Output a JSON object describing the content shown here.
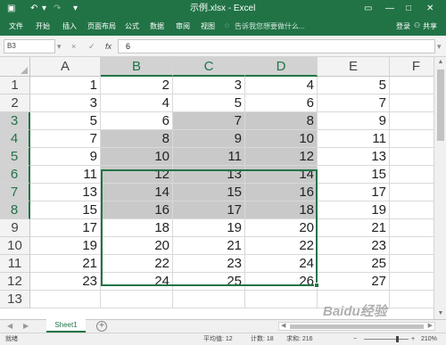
{
  "titlebar": {
    "title": "示例.xlsx - Excel",
    "login": "登录",
    "share": "共享"
  },
  "ribbon": {
    "tabs": [
      "文件",
      "开始",
      "插入",
      "页面布局",
      "公式",
      "数据",
      "审阅",
      "视图"
    ],
    "search_placeholder": "告诉我您想要做什么..."
  },
  "formula_bar": {
    "name_box": "B3",
    "cancel": "×",
    "enter": "✓",
    "fx": "fx",
    "value": "6"
  },
  "grid": {
    "columns": [
      "A",
      "B",
      "C",
      "D",
      "E",
      "F"
    ],
    "rows": [
      {
        "label": "1",
        "cells": [
          "1",
          "2",
          "3",
          "4",
          "5",
          ""
        ]
      },
      {
        "label": "2",
        "cells": [
          "3",
          "4",
          "5",
          "6",
          "7",
          ""
        ]
      },
      {
        "label": "3",
        "cells": [
          "5",
          "6",
          "7",
          "8",
          "9",
          ""
        ]
      },
      {
        "label": "4",
        "cells": [
          "7",
          "8",
          "9",
          "10",
          "11",
          ""
        ]
      },
      {
        "label": "5",
        "cells": [
          "9",
          "10",
          "11",
          "12",
          "13",
          ""
        ]
      },
      {
        "label": "6",
        "cells": [
          "11",
          "12",
          "13",
          "14",
          "15",
          ""
        ]
      },
      {
        "label": "7",
        "cells": [
          "13",
          "14",
          "15",
          "16",
          "17",
          ""
        ]
      },
      {
        "label": "8",
        "cells": [
          "15",
          "16",
          "17",
          "18",
          "19",
          ""
        ]
      },
      {
        "label": "9",
        "cells": [
          "17",
          "18",
          "19",
          "20",
          "21",
          ""
        ]
      },
      {
        "label": "10",
        "cells": [
          "19",
          "20",
          "21",
          "22",
          "23",
          ""
        ]
      },
      {
        "label": "11",
        "cells": [
          "21",
          "22",
          "23",
          "24",
          "25",
          ""
        ]
      },
      {
        "label": "12",
        "cells": [
          "23",
          "24",
          "25",
          "26",
          "27",
          ""
        ]
      },
      {
        "label": "13",
        "cells": [
          "",
          "",
          "",
          "",
          "",
          ""
        ]
      }
    ],
    "selection": "B3:D8",
    "active_cell": "B3"
  },
  "sheets": {
    "tabs": [
      "Sheet1"
    ],
    "add_label": "+"
  },
  "statusbar": {
    "mode": "就绪",
    "average": "平均值: 12",
    "count": "计数: 18",
    "sum": "求和: 216",
    "zoom": "210%"
  },
  "watermark": "Baidu经验",
  "colors": {
    "accent": "#217346",
    "selection_fill": "#c9c9c9",
    "header_bg": "#f3f3f3"
  }
}
